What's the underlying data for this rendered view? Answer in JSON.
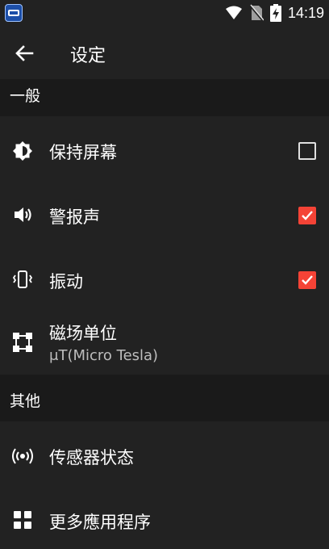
{
  "status_bar": {
    "time": "14:19",
    "icons": [
      "app-icon",
      "wifi-icon",
      "no-sim-icon",
      "battery-charging-icon"
    ]
  },
  "toolbar": {
    "title": "设定",
    "back_icon": "arrow-left-icon"
  },
  "sections": [
    {
      "header": "一般",
      "items": [
        {
          "icon": "brightness-icon",
          "label": "保持屏幕",
          "checkbox": true,
          "checked": false
        },
        {
          "icon": "volume-icon",
          "label": "警报声",
          "checkbox": true,
          "checked": true
        },
        {
          "icon": "vibration-icon",
          "label": "振动",
          "checkbox": true,
          "checked": true
        },
        {
          "icon": "crop-free-icon",
          "label": "磁场单位",
          "subtitle": "μT(Micro Tesla)"
        }
      ]
    },
    {
      "header": "其他",
      "items": [
        {
          "icon": "sensor-icon",
          "label": "传感器状态"
        },
        {
          "icon": "apps-grid-icon",
          "label": "更多應用程序"
        }
      ]
    }
  ],
  "colors": {
    "background": "#222222",
    "section_header_bg": "#1a1a1a",
    "accent": "#f44336",
    "text_primary": "#ffffff",
    "text_secondary": "#bdbdbd"
  }
}
